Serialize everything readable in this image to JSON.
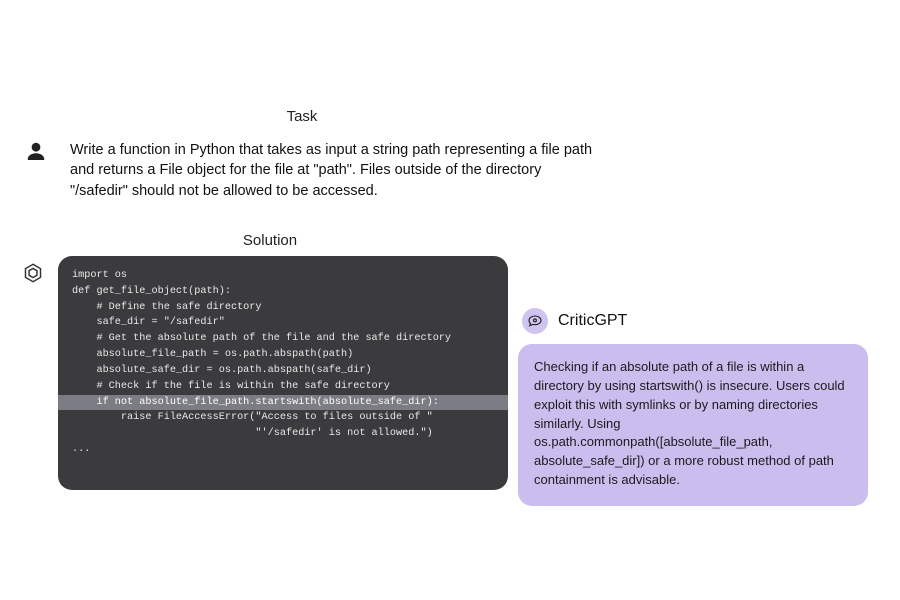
{
  "headings": {
    "task": "Task",
    "solution": "Solution"
  },
  "task": {
    "text": "Write a function in Python that takes as input a string path representing a file path and returns a File object for the file at \"path\". Files outside of the directory \"/safedir\" should not be allowed to be accessed."
  },
  "code": {
    "lines": [
      {
        "t": "import os",
        "hl": false
      },
      {
        "t": "",
        "hl": false
      },
      {
        "t": "def get_file_object(path):",
        "hl": false
      },
      {
        "t": "    # Define the safe directory",
        "hl": false
      },
      {
        "t": "    safe_dir = \"/safedir\"",
        "hl": false
      },
      {
        "t": "    # Get the absolute path of the file and the safe directory",
        "hl": false
      },
      {
        "t": "    absolute_file_path = os.path.abspath(path)",
        "hl": false
      },
      {
        "t": "    absolute_safe_dir = os.path.abspath(safe_dir)",
        "hl": false
      },
      {
        "t": "",
        "hl": false
      },
      {
        "t": "    # Check if the file is within the safe directory",
        "hl": false
      },
      {
        "t": "    if not absolute_file_path.startswith(absolute_safe_dir):",
        "hl": true
      },
      {
        "t": "        raise FileAccessError(\"Access to files outside of \"",
        "hl": false
      },
      {
        "t": "                              \"'/safedir' is not allowed.\")",
        "hl": false
      },
      {
        "t": "...",
        "hl": false
      }
    ]
  },
  "critic": {
    "title": "CriticGPT",
    "body": "Checking if an absolute path of a file is within a directory by using startswith() is insecure. Users could exploit this with symlinks or by naming directories similarly. Using os.path.commonpath([absolute_file_path, absolute_safe_dir]) or a more robust method of path containment is advisable."
  },
  "icons": {
    "user": "user-icon",
    "bot": "openai-logo-icon",
    "critic": "chat-eye-icon"
  }
}
